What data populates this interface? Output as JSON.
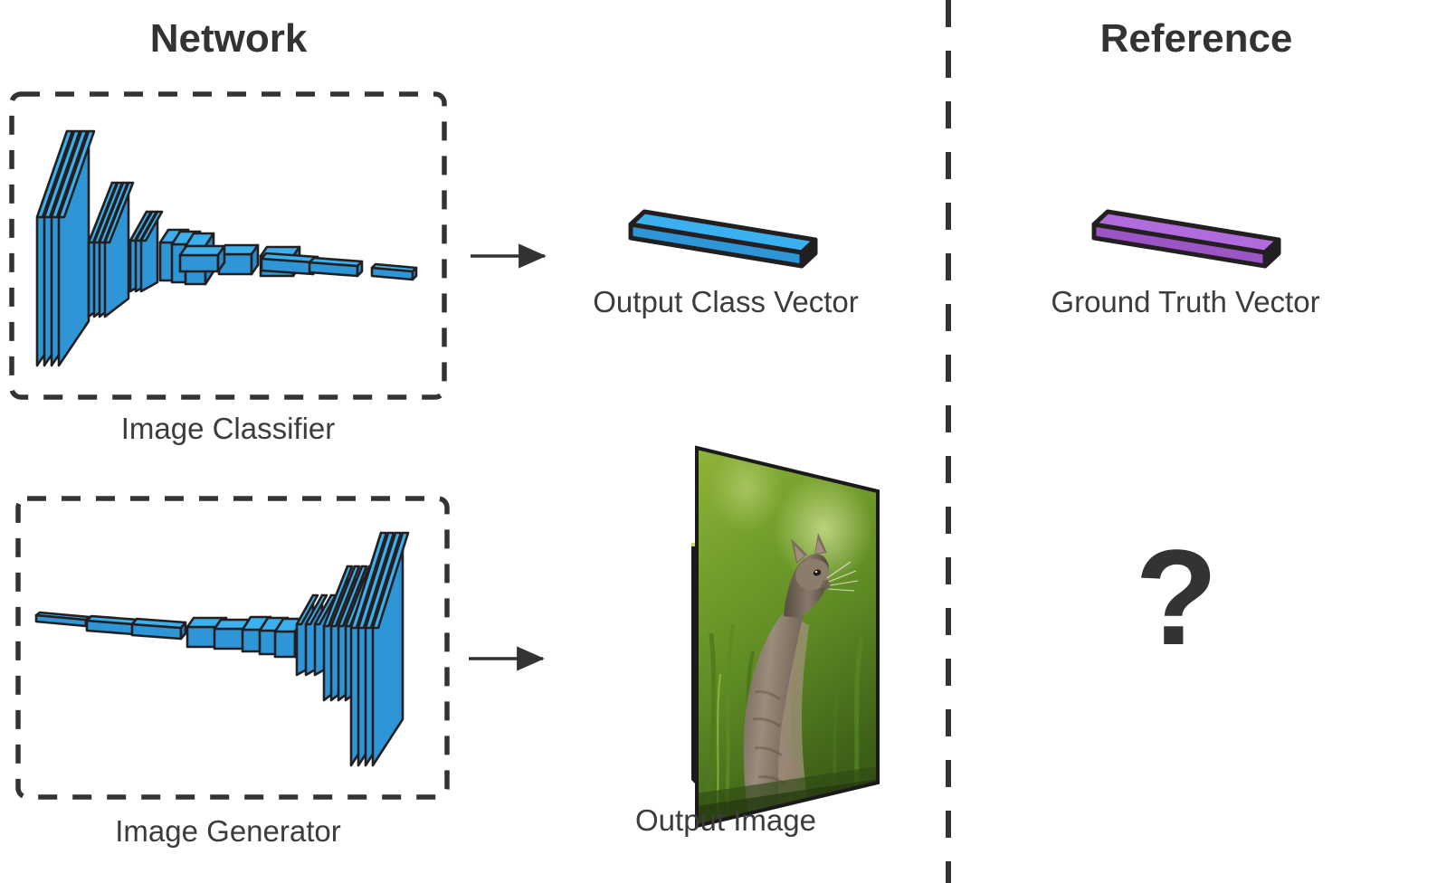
{
  "columns": {
    "network_title": "Network",
    "reference_title": "Reference"
  },
  "panels": {
    "classifier": {
      "caption": "Image Classifier",
      "box_style": "dashed",
      "net_type": "encoder"
    },
    "generator": {
      "caption": "Image Generator",
      "box_style": "dashed",
      "net_type": "decoder"
    }
  },
  "outputs": {
    "class_vector_caption": "Output Class Vector",
    "class_vector_color": "#3BA7E8",
    "image_caption": "Output Image",
    "image_subject": "cat-photo"
  },
  "reference": {
    "ground_truth_caption": "Ground Truth Vector",
    "ground_truth_color": "#A85FD0",
    "unknown_marker": "?"
  },
  "icons": {
    "arrow_top": "arrow-right-icon",
    "arrow_bottom": "arrow-right-icon",
    "divider": "vertical-dashed-divider"
  },
  "colors": {
    "layer_blue_front": "#2E96D6",
    "layer_blue_top": "#3BB0EF",
    "layer_blue_side": "#2E96D6",
    "stroke_dark": "#231f20",
    "text": "#333333",
    "purple_front": "#9B55C4",
    "purple_top": "#B06BDC",
    "grass_green": "#6F9B2E"
  }
}
